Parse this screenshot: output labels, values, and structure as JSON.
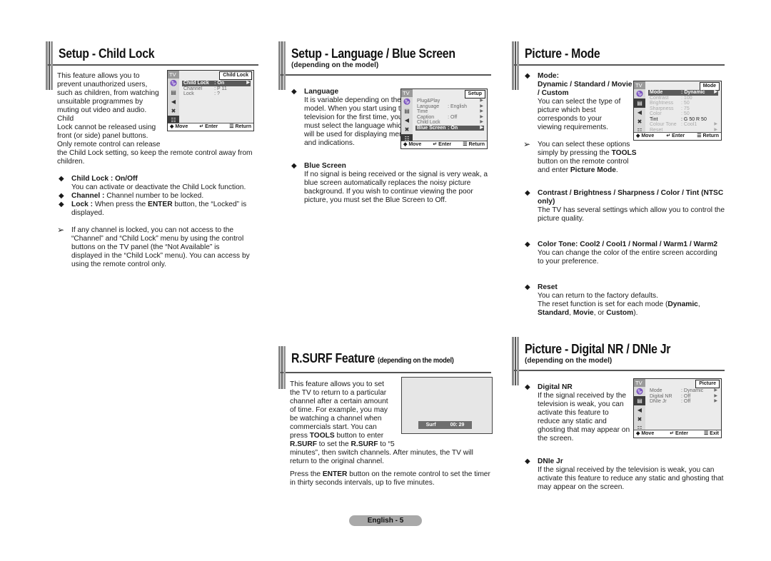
{
  "child_lock": {
    "title": "Setup - Child Lock",
    "intro": "This feature allows you to prevent unauthorized users, such as children, from watching unsuitable programmes by muting out video and audio. Child Lock cannot be released using front (or side) panel buttons. Only remote control can release the Child Lock setting, so keep the remote control away from children.",
    "intro_lines": [
      "This feature allows you to",
      "prevent unauthorized users,",
      "such as children, from watching",
      "unsuitable programmes by",
      "muting out video and audio. Child",
      "Lock cannot be released using",
      "front (or side) panel buttons.",
      "Only remote control can release"
    ],
    "intro_tail": "the Child Lock setting, so keep the remote control away from children.",
    "bullets": [
      {
        "head": "Child Lock : On/Off",
        "text": "You can activate or deactivate the Child Lock function."
      },
      {
        "head": "Channel :",
        "text": " Channel number to be locked."
      },
      {
        "head": "Lock :",
        "text_pre": " When press the ",
        "bold": "ENTER",
        "text_post": " button, the “Locked” is displayed."
      }
    ],
    "note": "If any channel is locked, you can not access to the “Channel” and “Child Lock” menu by using the control buttons on the TV panel (the “Not Available” is displayed in the “Child Lock” menu). You can access by using the remote control only.",
    "osd": {
      "tv": "TV",
      "title": "Child Lock",
      "rows": [
        {
          "label": "Child Lock",
          "value": ": On",
          "arrow": "▶"
        },
        {
          "label": "Channel",
          "value": ": P 11",
          "arrow": ""
        },
        {
          "label": "Lock",
          "value": ": ?",
          "arrow": ""
        }
      ],
      "footer": {
        "move": "◆ Move",
        "enter": "↵ Enter",
        "ret": "☰ Return"
      }
    }
  },
  "language": {
    "title": "Setup - Language / Blue Screen",
    "subtitle": "(depending on the model)",
    "lang_head": "Language",
    "lang_text": "It is variable depending on the model. When you start using the television for the first time, you must select the language which will be used for displaying menus and indications.",
    "blue_head": "Blue Screen",
    "blue_text": "If no signal is being received or the signal is very weak, a blue screen automatically replaces the noisy picture background. If you wish to continue viewing the poor picture, you must set the Blue Screen to Off.",
    "osd": {
      "tv": "TV",
      "title": "Setup",
      "rows": [
        {
          "label": "Plug&Play",
          "value": "",
          "arrow": "▶"
        },
        {
          "label": "Language",
          "value": ": English",
          "arrow": "▶"
        },
        {
          "label": "Time",
          "value": "",
          "arrow": "▶"
        },
        {
          "label": "Caption",
          "value": ": Off",
          "arrow": "▶"
        },
        {
          "label": "Child Lock",
          "value": "",
          "arrow": "▶"
        },
        {
          "label": "Blue Screen",
          "value": ": On",
          "arrow": "▶"
        }
      ],
      "footer": {
        "move": "◆ Move",
        "enter": "↵ Enter",
        "ret": "☰ Return"
      }
    }
  },
  "picture_mode": {
    "title": "Picture - Mode",
    "mode_head1": "Mode:",
    "mode_head2": "Dynamic / Standard / Movie / Custom",
    "mode_text": "You can select the type of picture which best corresponds to your viewing requirements.",
    "note_pre": "You can select these options simply by pressing the ",
    "note_b1": "TOOLS",
    "note_mid": " button on the remote control and enter ",
    "note_b2": "Picture Mode",
    "note_post": ".",
    "contrast_head": "Contrast / Brightness / Sharpness / Color / Tint (NTSC only)",
    "contrast_text": "The TV has several settings which allow you to control the picture quality.",
    "tone_head": "Color Tone: Cool2 / Cool1 / Normal / Warm1 / Warm2",
    "tone_text": "You can change the color of the entire screen according to your preference.",
    "reset_head": "Reset",
    "reset_text1": "You can return to the factory defaults.",
    "reset_text2_pre": "The reset function is set for each mode (",
    "reset_b1": "Dynamic",
    "reset_b2": "Standard",
    "reset_b3": "Movie",
    "reset_b4": "Custom",
    "osd": {
      "tv": "TV",
      "title": "Mode",
      "rows": [
        {
          "label": "Mode",
          "value": ":  Dynamic",
          "arrow": "▶"
        },
        {
          "label": "Contrast",
          "value": ":        100",
          "arrow": ""
        },
        {
          "label": "Brightness",
          "value": ":          50",
          "arrow": ""
        },
        {
          "label": "Sharpness",
          "value": ":          75",
          "arrow": ""
        },
        {
          "label": "Color",
          "value": ":          50",
          "arrow": ""
        },
        {
          "label": "Tint",
          "value": ": G 50   R 50",
          "arrow": ""
        },
        {
          "label": "Colour Tone",
          "value": ": Cool1",
          "arrow": "▶"
        },
        {
          "label": "Reset",
          "value": "",
          "arrow": "▶"
        }
      ],
      "footer": {
        "move": "◆ Move",
        "enter": "↵ Enter",
        "ret": "☰ Return"
      }
    }
  },
  "rsurf": {
    "title": "R.SURF Feature",
    "subtitle": "(depending on the model)",
    "text_pre": "This feature allows you to set the TV to return to a particular channel after a certain amount of time. For example, you may be watching a channel when commercials start. You can press ",
    "b1": "TOOLS",
    "mid1": " button to enter ",
    "b2": "R.SURF",
    "mid2": " to set the ",
    "b3": "R.SURF",
    "text_post": " to “5 minutes”, then switch channels. After minutes, the TV will return to the original channel.",
    "p2_pre": "Press the ",
    "p2_b": "ENTER",
    "p2_post": " button on the remote control to set the timer in thirty seconds intervals, up to five minutes.",
    "osd_label": "Surf",
    "osd_time": "00: 29"
  },
  "digital_nr": {
    "title": "Picture - Digital NR / DNIe Jr",
    "subtitle": "(depending on the model)",
    "dnr_head": "Digital NR",
    "dnr_text": "If the signal received by the television is weak, you can activate this feature to reduce any static and ghosting that may appear on the screen.",
    "dnie_head": "DNIe Jr",
    "dnie_text": "If the signal received by the television is weak, you can activate this feature to reduce any static and ghosting that may appear on the screen.",
    "osd": {
      "tv": "TV",
      "title": "Picture",
      "rows": [
        {
          "label": "Mode",
          "value": ":  Dynamic",
          "arrow": "▶"
        },
        {
          "label": "Digital NR",
          "value": ":          Off",
          "arrow": "▶"
        },
        {
          "label": "DNIe Jr",
          "value": ":          Off",
          "arrow": "▶"
        }
      ],
      "footer": {
        "move": "◆ Move",
        "enter": "↵ Enter",
        "ret": "☰ Exit"
      }
    }
  },
  "footer": {
    "page_label": "English - 5"
  },
  "glyphs": {
    "diamond": "◆",
    "arrow": "➢"
  }
}
